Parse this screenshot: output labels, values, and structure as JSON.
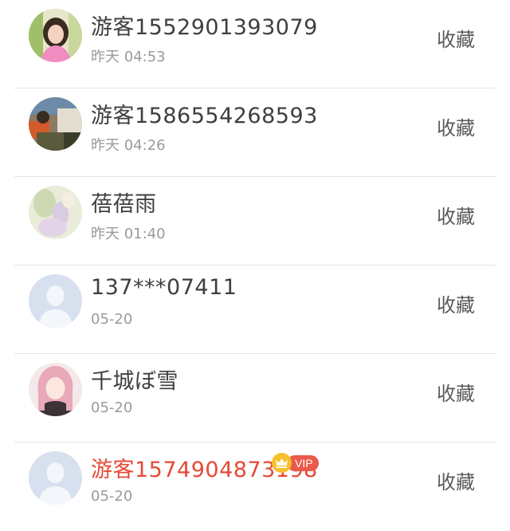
{
  "rows": [
    {
      "name": "游客1552901393079",
      "time": "昨天 04:53",
      "fav_label": "收藏",
      "vip": false
    },
    {
      "name": "游客1586554268593",
      "time": "昨天 04:26",
      "fav_label": "收藏",
      "vip": false
    },
    {
      "name": "蓓蓓雨",
      "time": "昨天 01:40",
      "fav_label": "收藏",
      "vip": false
    },
    {
      "name": "137***07411",
      "time": "05-20",
      "fav_label": "收藏",
      "vip": false
    },
    {
      "name": "千城ぼ雪",
      "time": "05-20",
      "fav_label": "收藏",
      "vip": false
    },
    {
      "name": "游客1574904873198",
      "time": "05-20",
      "fav_label": "收藏",
      "vip": true,
      "vip_label": "VIP"
    }
  ],
  "colors": {
    "name_default": "#3f3f3f",
    "name_vip": "#e64a36",
    "time": "#9a9a9a",
    "divider": "#e5e5e5",
    "vip_badge": "#e95a4a",
    "vip_crown": "#f6bf2c"
  }
}
